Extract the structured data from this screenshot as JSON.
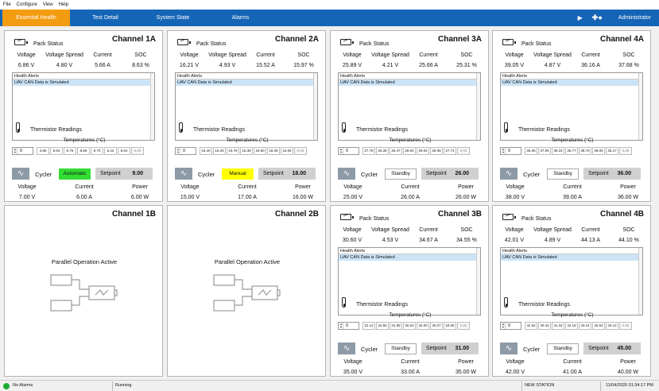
{
  "menu": [
    "File",
    "Configure",
    "View",
    "Help"
  ],
  "tabs": [
    "Essential Health",
    "Test Detail",
    "System State",
    "Alarms"
  ],
  "user": "Administrator",
  "labels": {
    "pack_status": "Pack Status",
    "voltage": "Voltage",
    "voltage_spread": "Voltage Spread",
    "current": "Current",
    "soc": "SOC",
    "health_alerts": "Health Alerts",
    "thermistor": "Thermistor Readings",
    "temps": "Temperatures (°C)",
    "cycler": "Cycler",
    "setpoint": "Setpoint",
    "power": "Power",
    "parallel": "Parallel Operation Active"
  },
  "colors": {
    "nav": "#1565b7",
    "active_tab": "#f39c12",
    "automatic": "#33dd33",
    "manual": "#ffff00"
  },
  "channels": [
    {
      "name": "Channel 1A",
      "voltage": "6.86 V",
      "spread": "4.80 V",
      "current": "5.66 A",
      "soc": "8.63 %",
      "alert": "UAV CAN Data is Simulated",
      "spin": "0",
      "temps": [
        "4.55",
        "5.64",
        "8.75",
        "8.65",
        "8.70",
        "6.22",
        "6.54",
        "0.00"
      ],
      "mode": "Automatic",
      "mode_color": "#33dd33",
      "setpoint": "9.00",
      "cv": "7.00 V",
      "cc": "6.00 A",
      "cp": "6.00 W"
    },
    {
      "name": "Channel 2A",
      "voltage": "16.21 V",
      "spread": "4.93 V",
      "current": "15.52 A",
      "soc": "15.97 %",
      "alert": "UAV CAN Data is Simulated",
      "spin": "0",
      "temps": [
        "15.40",
        "15.29",
        "19.76",
        "15.38",
        "18.60",
        "18.39",
        "16.06",
        "0.00"
      ],
      "mode": "Manual",
      "mode_color": "#ffff00",
      "setpoint": "18.00",
      "cv": "15.00 V",
      "cc": "17.00 A",
      "cp": "16.00 W"
    },
    {
      "name": "Channel 3A",
      "voltage": "25.89 V",
      "spread": "4.21 V",
      "current": "25.66 A",
      "soc": "25.31 %",
      "alert": "UAV CAN Data is Simulated",
      "spin": "0",
      "temps": [
        "27.78",
        "26.36",
        "26.47",
        "28.04",
        "29.94",
        "26.06",
        "27.74",
        "0.00"
      ],
      "mode": "Standby",
      "mode_color": "#ffffff",
      "setpoint": "26.00",
      "cv": "25.00 V",
      "cc": "26.00 A",
      "cp": "26.00 W"
    },
    {
      "name": "Channel 4A",
      "voltage": "39.05 V",
      "spread": "4.87 V",
      "current": "36.16 A",
      "soc": "37.68 %",
      "alert": "UAV CAN Data is Simulated",
      "spin": "0",
      "temps": [
        "36.36",
        "37.05",
        "38.33",
        "36.77",
        "38.70",
        "38.05",
        "35.17",
        "0.00"
      ],
      "mode": "Standby",
      "mode_color": "#ffffff",
      "setpoint": "36.00",
      "cv": "38.00 V",
      "cc": "39.00 A",
      "cp": "36.00 W"
    },
    {
      "name": "Channel 1B"
    },
    {
      "name": "Channel 2B"
    },
    {
      "name": "Channel 3B",
      "voltage": "30.60 V",
      "spread": "4.53 V",
      "current": "34.67 A",
      "soc": "34.55 %",
      "alert": "UAV CAN Data is Simulated",
      "spin": "0",
      "temps": [
        "31.12",
        "32.55",
        "31.99",
        "30.04",
        "32.00",
        "30.07",
        "33.06",
        "0.00"
      ],
      "mode": "Standby",
      "mode_color": "#ffffff",
      "setpoint": "31.00",
      "cv": "35.00 V",
      "cc": "33.00 A",
      "cp": "35.00 W"
    },
    {
      "name": "Channel 4B",
      "voltage": "42.01 V",
      "spread": "4.89 V",
      "current": "44.13 A",
      "soc": "44.10 %",
      "alert": "UAV CAN Data is Simulated",
      "spin": "0",
      "temps": [
        "42.52",
        "40.42",
        "41.32",
        "42.18",
        "43.24",
        "40.54",
        "40.12",
        "0.00"
      ],
      "mode": "Standby",
      "mode_color": "#ffffff",
      "setpoint": "45.00",
      "cv": "42.00 V",
      "cc": "41.00 A",
      "cp": "40.00 W"
    }
  ],
  "status": {
    "alarms": "No Alarms",
    "running": "Running",
    "station": "NEW STATION",
    "datetime": "11/04/2020 01:34:17 PM"
  }
}
